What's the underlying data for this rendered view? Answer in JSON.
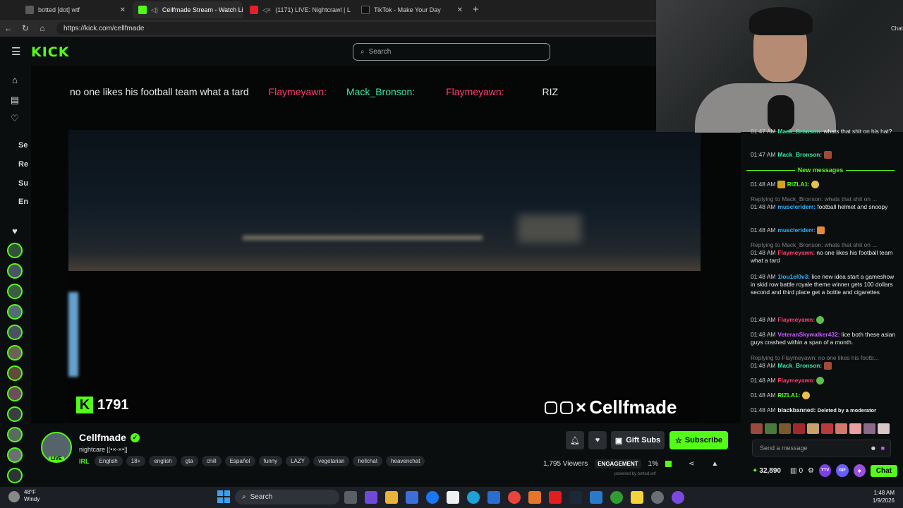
{
  "browser": {
    "tabs": [
      {
        "title": "botted [dot] wtf",
        "fav_color": "#5a5a5a",
        "active": false
      },
      {
        "title": "Cellfmade Stream - Watch Li",
        "fav_color": "#53fc18",
        "active": true
      },
      {
        "title": "(1171) LIVE: Nightcrawl | L",
        "fav_color": "#e0202a",
        "active": false
      },
      {
        "title": "TikTok - Make Your Day",
        "fav_color": "#111111",
        "active": false
      }
    ],
    "new_tab": "+",
    "url": "https://kick.com/cellfmade"
  },
  "kick": {
    "logo": "KICK",
    "search_placeholder": "Search",
    "nav_labels": [
      "Se",
      "Re",
      "Su",
      "En"
    ]
  },
  "stream": {
    "overlay_chat": "no one likes his football team what a tard",
    "overlay_user1": "Flaymeyawn:",
    "overlay_user2": "Mack_Bronson:",
    "overlay_user3": "Flaymeyawn:",
    "overlay_tail": "RIZ",
    "viewer_overlay": "1791",
    "watermark": "Cellfmade"
  },
  "channel": {
    "name": "Cellfmade",
    "live_label": "LIVE",
    "subtitle": "nightcare |¦•×-×•¦|",
    "category": "IRL",
    "tags": [
      "English",
      "18+",
      "english",
      "gta",
      "chill",
      "Español",
      "funny",
      "LAZY",
      "vegetarian",
      "hellchat",
      "heavenchat"
    ],
    "gift_label": "Gift Subs",
    "subscribe_label": "Subscribe",
    "viewers": "1,795 Viewers",
    "engagement_label": "ENGAGEMENT",
    "engagement_value": "1%",
    "powered": "powered by botted.wtf"
  },
  "chat": {
    "new_messages_label": "New messages",
    "send_placeholder": "Send a message",
    "points": "32,890",
    "zero": "0",
    "chat_button": "Chat",
    "header_frag": "Chat",
    "messages": [
      {
        "time": "01:47 AM",
        "user": "Mack_Bronson:",
        "color": "#3ce6a5",
        "text": "whats that shit on his hat?",
        "reply": ""
      },
      {
        "time": "01:47 AM",
        "user": "Mack_Bronson:",
        "color": "#3ce6a5",
        "text": "",
        "reply": ""
      },
      {
        "time": "01:48 AM",
        "user": "RIZLA1:",
        "color": "#53fc18",
        "text": "",
        "reply": ""
      },
      {
        "time": "01:48 AM",
        "user": "muscleriderr:",
        "color": "#2fb6ff",
        "text": "football helmet and snoopy",
        "reply": "Replying to Mack_Bronson: whats that shit on ..."
      },
      {
        "time": "01:48 AM",
        "user": "muscleriderr:",
        "color": "#2fb6ff",
        "text": "",
        "reply": ""
      },
      {
        "time": "01:48 AM",
        "user": "Flaymeyawn:",
        "color": "#ff3f6f",
        "text": "no one likes his football team what a tard",
        "reply": "Replying to Mack_Bronson: whats that shit on ..."
      },
      {
        "time": "01:48 AM",
        "user": "1lou1el0v3:",
        "color": "#2fb6ff",
        "text": "lice new idea start a gameshow in skid row battle royale theme winner gets 100 dollars second and third place get a bottle and cigarettes",
        "reply": ""
      },
      {
        "time": "01:48 AM",
        "user": "Flaymeyawn:",
        "color": "#ff3f6f",
        "text": "",
        "reply": ""
      },
      {
        "time": "01:48 AM",
        "user": "VeteranSkywalker432:",
        "color": "#c75cff",
        "text": "lice both these asian guys crashed within a span of a month.",
        "reply": ""
      },
      {
        "time": "01:48 AM",
        "user": "Mack_Bronson:",
        "color": "#3ce6a5",
        "text": "",
        "reply": "Replying to Flaymeyawn: no one likes his footb..."
      },
      {
        "time": "01:48 AM",
        "user": "Flaymeyawn:",
        "color": "#ff3f6f",
        "text": "",
        "reply": ""
      },
      {
        "time": "01:48 AM",
        "user": "RIZLA1:",
        "color": "#53fc18",
        "text": "",
        "reply": ""
      },
      {
        "time": "01:48 AM",
        "user": "blackbanned:",
        "color": "#eeeeee",
        "text": "Deleted by a moderator",
        "reply": ""
      }
    ]
  },
  "taskbar": {
    "temp": "48°F",
    "condition": "Windy",
    "search": "Search",
    "time": "1:48 AM",
    "date": "1/9/2026"
  },
  "colors": {
    "kick_green": "#53fc18",
    "bg": "#0b0e0f"
  }
}
